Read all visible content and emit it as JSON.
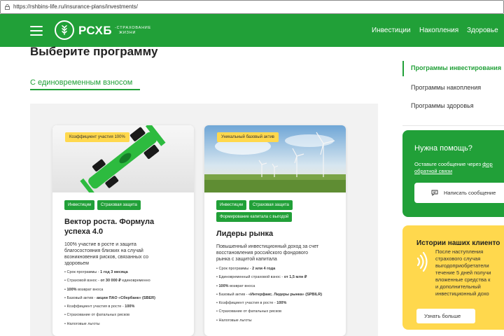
{
  "browser": {
    "url": "https://rshbins-life.ru/insurance-plans/investments/"
  },
  "header": {
    "logo_text": "РСХБ",
    "logo_sub_line1": "-СТРАХОВАНИЕ",
    "logo_sub_line2": "ЖИЗНИ",
    "nav": [
      "Инвестиции",
      "Накопления",
      "Здоровье"
    ],
    "brand_color": "#21a038"
  },
  "main": {
    "title": "Выберите программу",
    "tab": "С единовременным взносом"
  },
  "cards": [
    {
      "badge": "Коэффициент участия 100%",
      "tags": [
        "Инвестиции",
        "Страховая защита"
      ],
      "title_line1": "Вектор роста. Формула",
      "title_line2": "успеха 4.0",
      "desc_lines": [
        "100% участие в росте и защита",
        "благосостояния близких на случай",
        "возникновения рисков, связанных со",
        "здоровьем"
      ],
      "list": [
        {
          "label": "Срок программы - ",
          "value": "1 год 3 месяца"
        },
        {
          "label": "Страховой взнос - ",
          "value": "от 30 000 ₽",
          "suffix": " единовременно"
        },
        {
          "label": "",
          "value": "100%",
          "suffix": " возврат вноса"
        },
        {
          "label": "Базовый актив - ",
          "value": "акции ПАО «Сбербанк» (SBER)"
        },
        {
          "label": "Коэффициент участия в росте - ",
          "value": "100%"
        },
        {
          "label": "Страхование от фатальных рисков",
          "value": ""
        },
        {
          "label": "Налоговые льготы",
          "value": ""
        }
      ]
    },
    {
      "badge": "Уникальный базовый актив",
      "tags": [
        "Инвестиции",
        "Страховая защита",
        "Формирование капитала с выгодой"
      ],
      "title_line1": "Лидеры рынка",
      "title_line2": "",
      "desc_lines": [
        "Повышенный инвестиционный доход за счет",
        "восстановления российского фондового",
        "рынка с защитой капитала"
      ],
      "list": [
        {
          "label": "Срок программы - ",
          "value": "2 или 4 года"
        },
        {
          "label": "Единовременный страховой взнос - ",
          "value": "от 1,5 млн ₽"
        },
        {
          "label": "",
          "value": "100%",
          "suffix": " возврат вноса"
        },
        {
          "label": "Базовый актив - ",
          "value": "«Интерфакс. Лидеры рынка» (SPBILR)"
        },
        {
          "label": "Коэффициент участия в росте - ",
          "value": "100%"
        },
        {
          "label": "Страхование от фатальных рисков",
          "value": ""
        },
        {
          "label": "Налоговые льготы",
          "value": ""
        }
      ]
    }
  ],
  "sidebar": {
    "items": [
      "Программы инвестирования",
      "Программы накопления",
      "Программы здоровья"
    ]
  },
  "help": {
    "title": "Нужна помощь?",
    "text_line1_prefix": "Оставьте сообщение через ",
    "text_line1_link": "фор",
    "text_line2_link": "обратной связи",
    "button": "Написать сообщение"
  },
  "stories": {
    "title": "Истории наших клиенто",
    "text_lines": [
      "После наступления",
      "страхового случая",
      "выгодоприобретатели",
      "течение 5 дней получи",
      "вложенные средства к",
      "и дополнительный",
      "инвестиционный дохо"
    ],
    "button": "Узнать больше"
  }
}
